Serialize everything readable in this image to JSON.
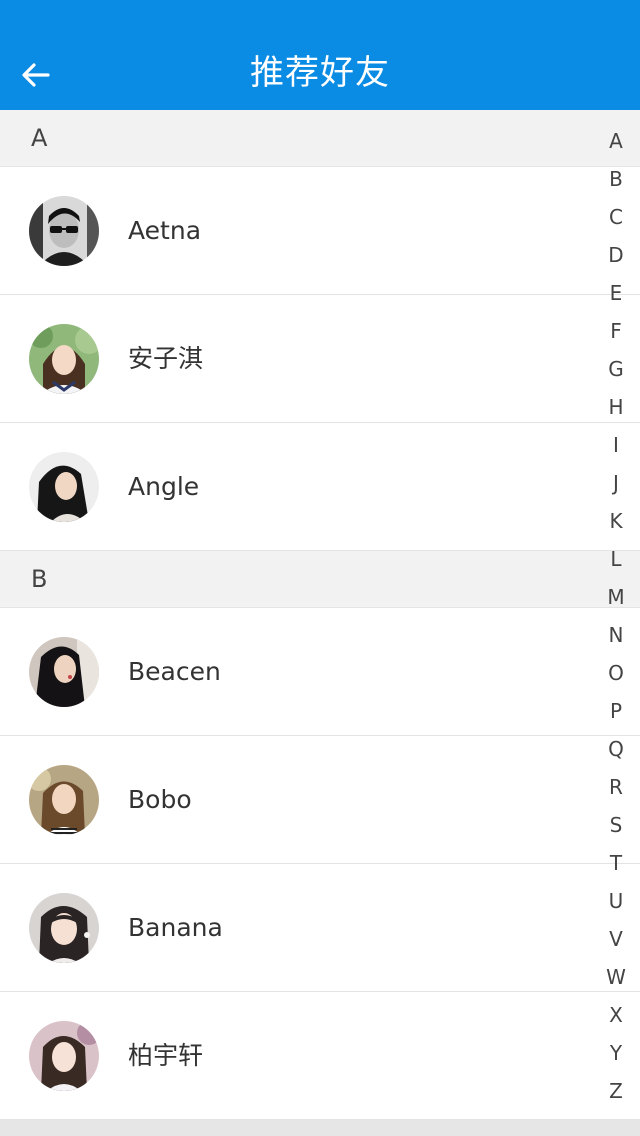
{
  "header": {
    "title": "推荐好友"
  },
  "sections": [
    {
      "letter": "A",
      "contacts": [
        {
          "name": "Aetna"
        },
        {
          "name": "安子淇"
        },
        {
          "name": "Angle"
        }
      ]
    },
    {
      "letter": "B",
      "contacts": [
        {
          "name": "Beacen"
        },
        {
          "name": "Bobo"
        },
        {
          "name": "Banana"
        },
        {
          "name": "柏宇轩"
        }
      ]
    }
  ],
  "index": [
    "A",
    "B",
    "C",
    "D",
    "E",
    "F",
    "G",
    "H",
    "I",
    "J",
    "K",
    "L",
    "M",
    "N",
    "O",
    "P",
    "Q",
    "R",
    "S",
    "T",
    "U",
    "V",
    "W",
    "X",
    "Y",
    "Z"
  ],
  "colors": {
    "header": "#0a8be4",
    "section_bg": "#f2f2f2"
  }
}
